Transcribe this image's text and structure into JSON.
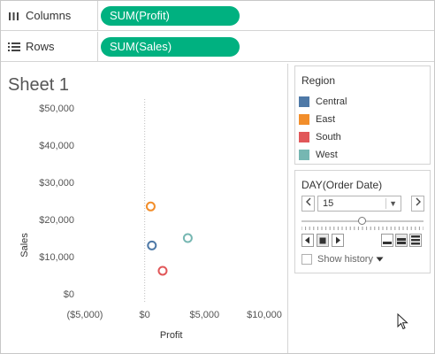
{
  "shelves": {
    "columns": {
      "label": "Columns",
      "pill": "SUM(Profit)"
    },
    "rows": {
      "label": "Rows",
      "pill": "SUM(Sales)"
    }
  },
  "sheet": {
    "title": "Sheet 1"
  },
  "chart_data": {
    "type": "scatter",
    "xlabel": "Profit",
    "ylabel": "Sales",
    "xlim": [
      -5000,
      10000
    ],
    "ylim": [
      0,
      50000
    ],
    "x_ticks": [
      {
        "value": -5000,
        "label": "($5,000)"
      },
      {
        "value": 0,
        "label": "$0"
      },
      {
        "value": 5000,
        "label": "$5,000"
      },
      {
        "value": 10000,
        "label": "$10,000"
      }
    ],
    "y_ticks": [
      {
        "value": 0,
        "label": "$0"
      },
      {
        "value": 10000,
        "label": "$10,000"
      },
      {
        "value": 20000,
        "label": "$20,000"
      },
      {
        "value": 30000,
        "label": "$30,000"
      },
      {
        "value": 40000,
        "label": "$40,000"
      },
      {
        "value": 50000,
        "label": "$50,000"
      }
    ],
    "zero_reference_line": true,
    "series": [
      {
        "name": "Central",
        "color": "#4e79a7",
        "x": 600,
        "y": 13000
      },
      {
        "name": "East",
        "color": "#f28e2b",
        "x": 500,
        "y": 23500
      },
      {
        "name": "South",
        "color": "#e15759",
        "x": 1500,
        "y": 6200
      },
      {
        "name": "West",
        "color": "#76b7b2",
        "x": 3600,
        "y": 15000
      }
    ]
  },
  "legend": {
    "title": "Region",
    "items": [
      {
        "label": "Central",
        "color": "#4e79a7"
      },
      {
        "label": "East",
        "color": "#f28e2b"
      },
      {
        "label": "South",
        "color": "#e15759"
      },
      {
        "label": "West",
        "color": "#76b7b2"
      }
    ]
  },
  "pages": {
    "title": "DAY(Order Date)",
    "selected_value": "15",
    "prev_label": "<",
    "next_label": ">",
    "show_history_label": "Show history",
    "slider_position": 0.5
  },
  "colors": {
    "pill": "#00b180"
  }
}
